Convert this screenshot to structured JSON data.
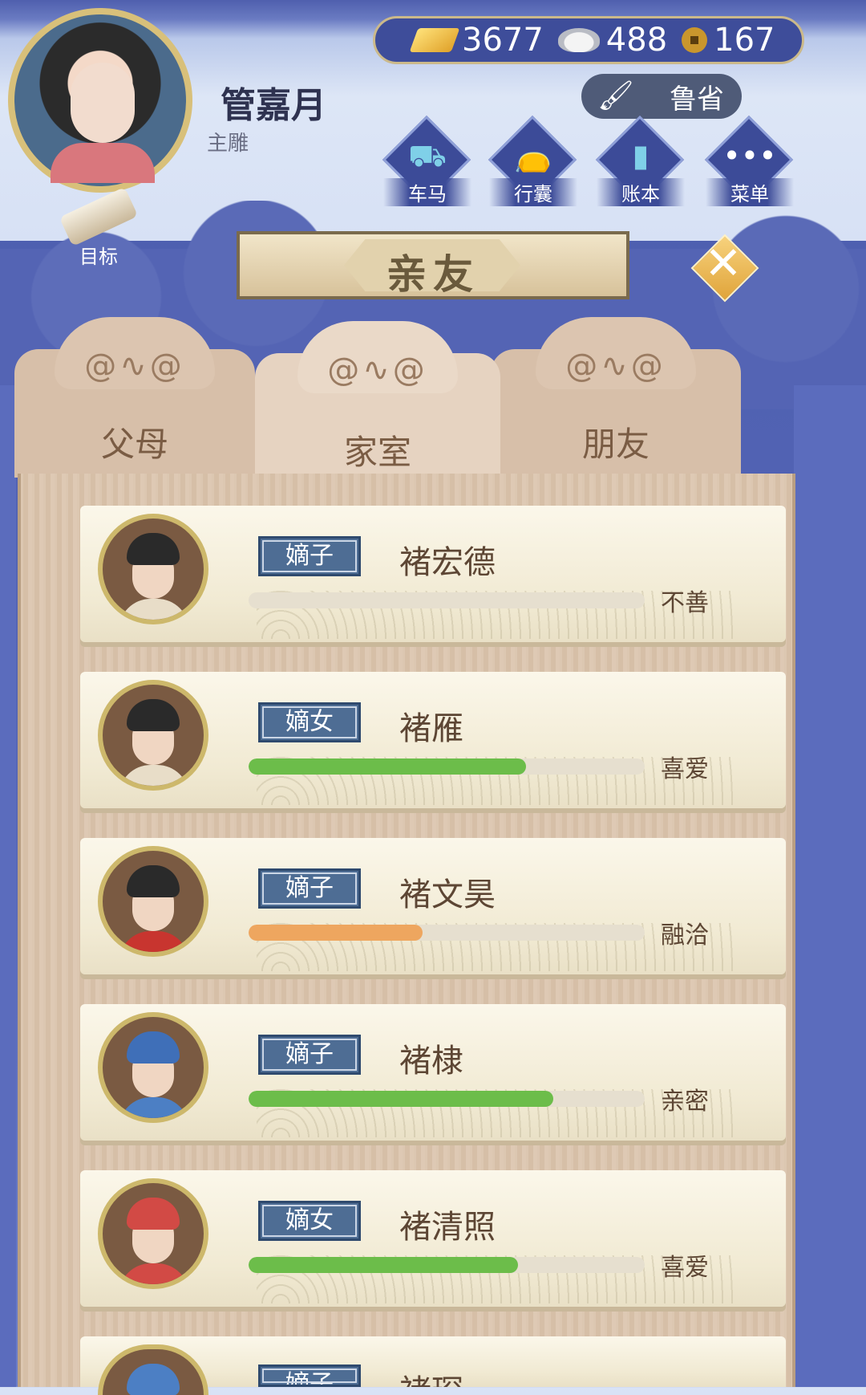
{
  "player": {
    "name": "管嘉月",
    "title": "主雕"
  },
  "currency": {
    "gold": "3677",
    "silver": "488",
    "coin": "167"
  },
  "location": "鲁省",
  "menu": [
    {
      "label": "车马",
      "icon": "carriage-icon"
    },
    {
      "label": "行囊",
      "icon": "bag-icon"
    },
    {
      "label": "账本",
      "icon": "ledger-icon"
    },
    {
      "label": "菜单",
      "icon": "more-icon"
    }
  ],
  "goal_label": "目标",
  "screen_title": "亲友",
  "tabs": [
    {
      "label": "父母",
      "active": false
    },
    {
      "label": "家室",
      "active": true
    },
    {
      "label": "朋友",
      "active": false
    }
  ],
  "members": [
    {
      "role": "嫡子",
      "name": "褚宏德",
      "relation": "不善",
      "affinity": 0.0,
      "bar_color": "#e6dfcf"
    },
    {
      "role": "嫡女",
      "name": "褚雁",
      "relation": "喜爱",
      "affinity": 0.7,
      "bar_color": "#6cbd4a"
    },
    {
      "role": "嫡子",
      "name": "褚文昊",
      "relation": "融洽",
      "affinity": 0.44,
      "bar_color": "#eea65f"
    },
    {
      "role": "嫡子",
      "name": "褚棣",
      "relation": "亲密",
      "affinity": 0.77,
      "bar_color": "#6cbd4a"
    },
    {
      "role": "嫡女",
      "name": "褚清照",
      "relation": "喜爱",
      "affinity": 0.68,
      "bar_color": "#6cbd4a"
    },
    {
      "role": "嫡子",
      "name": "褚琛",
      "relation": "",
      "affinity": 0.0,
      "bar_color": "#e6dfcf"
    }
  ]
}
